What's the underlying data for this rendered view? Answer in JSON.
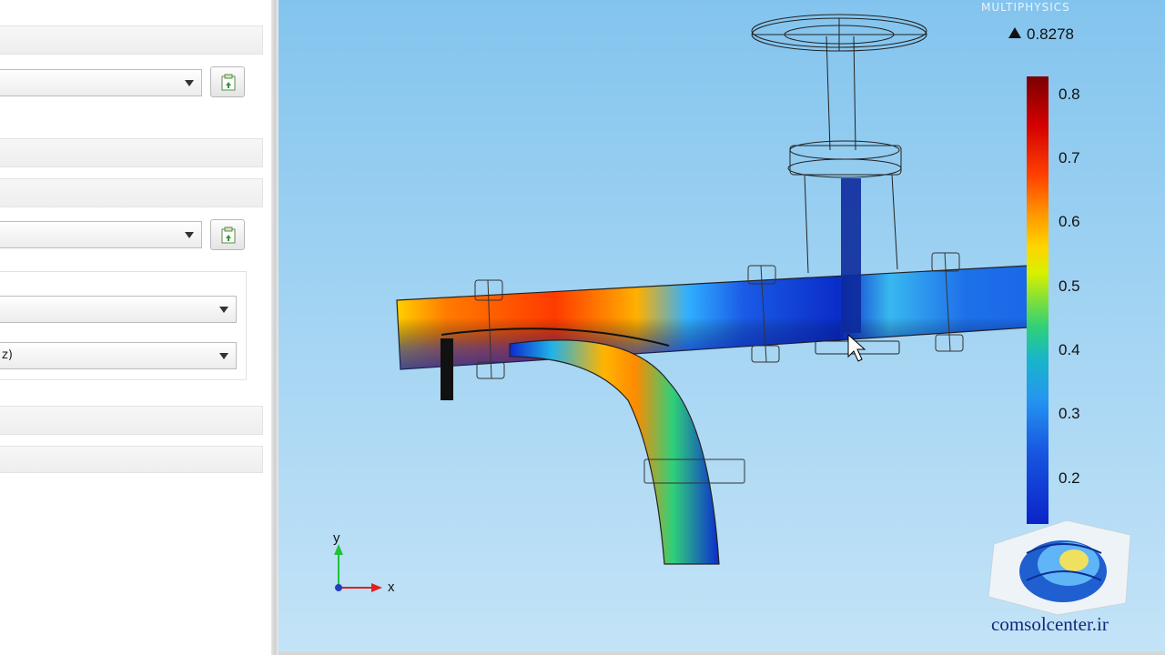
{
  "left_panel": {
    "combo_3_value": "",
    "combo_4_value": "z)"
  },
  "viewport": {
    "watermark": "MULTIPHYSICS",
    "max_value": "0.8278",
    "colorbar_ticks": [
      "0.8",
      "0.7",
      "0.6",
      "0.5",
      "0.4",
      "0.3",
      "0.2"
    ],
    "axis": {
      "y_label": "y",
      "x_label": "x"
    },
    "brand": "comsolcenter.ir",
    "colormap": [
      "#0b23c8",
      "#2596f0",
      "#2fd07a",
      "#d8f000",
      "#ff9900",
      "#d40000",
      "#7a0000"
    ]
  }
}
